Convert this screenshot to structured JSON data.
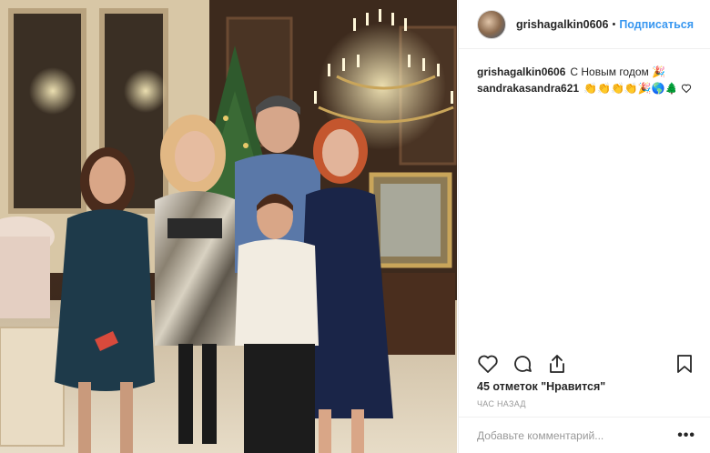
{
  "photo": {
    "alt_icon": "family-photo"
  },
  "header": {
    "username": "grishagalkin0606",
    "dot": "•",
    "follow_label": "Подписаться"
  },
  "comments": [
    {
      "user": "grishagalkin0606",
      "text": "С Новым годом 🎉"
    },
    {
      "user": "sandrakasandra621",
      "text": "👏👏👏👏🎉🌎🌲🎉"
    }
  ],
  "actions": {
    "like_icon": "heart-icon",
    "comment_icon": "comment-icon",
    "share_icon": "share-icon",
    "save_icon": "bookmark-icon"
  },
  "likes": {
    "count": "45 отметок",
    "suffix": " \"Нравится\""
  },
  "time": "ЧАС НАЗАД",
  "add_comment": {
    "placeholder": "Добавьте комментарий...",
    "more": "•••"
  },
  "colors": {
    "link": "#3897f0",
    "border": "#efefef",
    "muted": "#999999"
  }
}
